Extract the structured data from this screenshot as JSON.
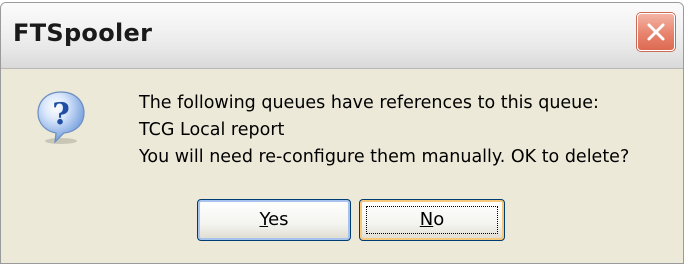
{
  "window": {
    "title": "FTSpooler",
    "close_icon": "close-icon"
  },
  "dialog": {
    "icon": "question-icon",
    "message_lines": [
      "The following queues have references to this queue:",
      "TCG Local report",
      "You will need re-configure them manually. OK to delete?"
    ]
  },
  "buttons": {
    "yes": {
      "accel": "Y",
      "rest": "es",
      "label": "Yes"
    },
    "no": {
      "accel": "N",
      "rest": "o",
      "label": "No"
    }
  },
  "colors": {
    "dialog_bg": "#ece9d8",
    "close_button": "#e07a63",
    "icon_blue": "#2d5fb3"
  }
}
